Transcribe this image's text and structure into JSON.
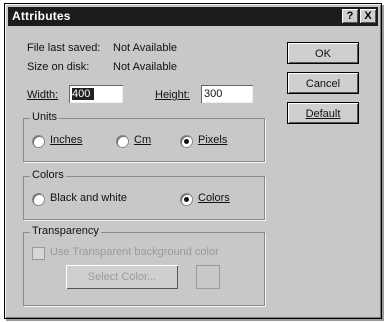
{
  "title": "Attributes",
  "title_buttons": {
    "help": "?",
    "close": "X"
  },
  "info": {
    "last_saved_label": "File last saved:",
    "last_saved_value": "Not Available",
    "size_label": "Size on disk:",
    "size_value": "Not Available"
  },
  "width": {
    "label": "Width:",
    "value": "400"
  },
  "height": {
    "label": "Height:",
    "value": "300"
  },
  "units": {
    "title": "Units",
    "options": [
      "Inches",
      "Cm",
      "Pixels"
    ],
    "selected": "Pixels"
  },
  "colors": {
    "title": "Colors",
    "options": [
      "Black and white",
      "Colors"
    ],
    "selected": "Colors"
  },
  "transparency": {
    "title": "Transparency",
    "checkbox_label": "Use Transparent background color",
    "select_color_label": "Select Color..."
  },
  "buttons": {
    "ok": "OK",
    "cancel": "Cancel",
    "default": "Default"
  }
}
